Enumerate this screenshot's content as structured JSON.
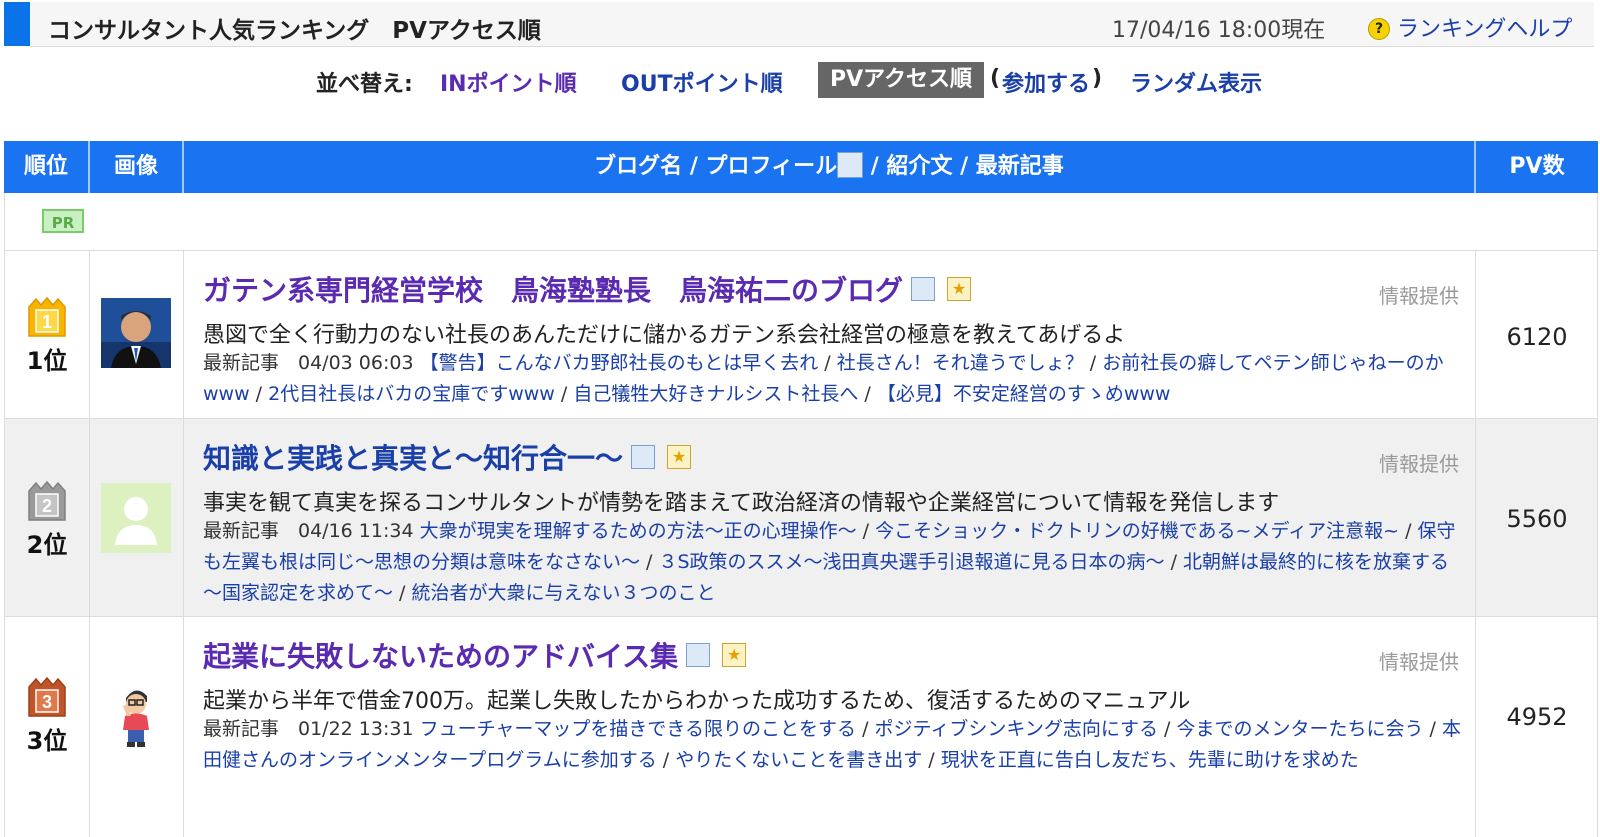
{
  "header": {
    "title": "コンサルタント人気ランキング　PVアクセス順",
    "timestamp": "17/04/16 18:00現在",
    "help_link": "ランキングヘルプ"
  },
  "sort": {
    "label": "並べ替え:",
    "in_points": "INポイント順",
    "out_points": "OUTポイント順",
    "pv_access": "PVアクセス順",
    "paren_open": "(",
    "join": "参加する",
    "paren_close": ")",
    "random": "ランダム表示"
  },
  "table": {
    "col_rank": "順位",
    "col_image": "画像",
    "col_blog_a": "ブログ名 / プロフィール",
    "col_blog_b": " / 紹介文 / 最新記事",
    "col_pv": "PV数",
    "pr": "PR"
  },
  "rows": [
    {
      "rank_num": "1",
      "rank": "1位",
      "title": "ガテン系専門経営学校　鳥海塾塾長　鳥海祐二のブログ",
      "info": "情報提供",
      "description": "愚図で全く行動力のない社長のあんただけに儲かるガテン系会社経営の極意を教えてあげるよ",
      "latest_label": "最新記事　04/03 06:03",
      "articles": [
        "【警告】こんなバカ野郎社長のもとは早く去れ",
        "社長さん！それ違うでしょ？",
        "お前社長の癖してペテン師じゃねーのかwww",
        "2代目社長はバカの宝庫ですwww",
        "自己犠牲大好きナルシスト社長へ",
        "【必見】不安定経営のすゝめwww"
      ],
      "pv": "6120"
    },
    {
      "rank_num": "2",
      "rank": "2位",
      "title": "知識と実践と真実と～知行合一～",
      "info": "情報提供",
      "description": "事実を観て真実を探るコンサルタントが情勢を踏まえて政治経済の情報や企業経営について情報を発信します",
      "latest_label": "最新記事　04/16 11:34",
      "articles": [
        "大衆が現実を理解するための方法～正の心理操作～",
        "今こそショック・ドクトリンの好機である~メディア注意報~",
        "保守も左翼も根は同じ～思想の分類は意味をなさない～",
        "３S政策のススメ～浅田真央選手引退報道に見る日本の病～",
        "北朝鮮は最終的に核を放棄する～国家認定を求めて～",
        "統治者が大衆に与えない３つのこと"
      ],
      "pv": "5560"
    },
    {
      "rank_num": "3",
      "rank": "3位",
      "title": "起業に失敗しないためのアドバイス集",
      "info": "情報提供",
      "description": "起業から半年で借金700万。起業し失敗したからわかった成功するため、復活するためのマニュアル",
      "latest_label": "最新記事　01/22 13:31",
      "articles": [
        "フューチャーマップを描きできる限りのことをする",
        "ポジティブシンキング志向にする",
        "今までのメンターたちに会う",
        "本田健さんのオンラインメンタープログラムに参加する",
        "やりたくないことを書き出す",
        "現状を正直に告白し友だち、先輩に助けを求めた"
      ],
      "pv": "4952"
    }
  ]
}
